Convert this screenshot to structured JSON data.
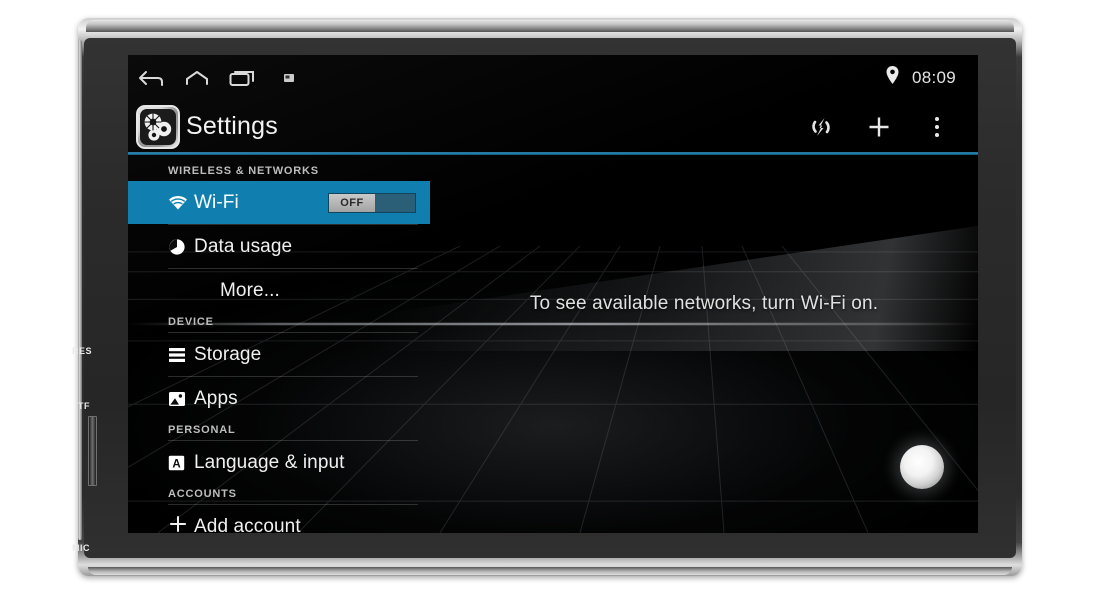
{
  "device": {
    "bezel_labels": [
      {
        "name": "reset",
        "text": "RES"
      },
      {
        "name": "tf-card-slot",
        "text": "TF"
      },
      {
        "name": "microphone",
        "text": "MIC"
      }
    ]
  },
  "statusbar": {
    "nav": [
      {
        "name": "back-icon",
        "label": "Back"
      },
      {
        "name": "home-icon",
        "label": "Home"
      },
      {
        "name": "recents-icon",
        "label": "Recent apps"
      },
      {
        "name": "screenshot-icon",
        "label": "Screenshot"
      }
    ],
    "location_icon": "location-pin-icon",
    "time": "08:09"
  },
  "actionbar": {
    "app_icon": "settings-gear-icon",
    "title": "Settings",
    "actions": [
      {
        "name": "sync-icon",
        "label": "Sync"
      },
      {
        "name": "add-icon",
        "label": "+"
      },
      {
        "name": "overflow-menu-icon",
        "label": "More options"
      }
    ],
    "divider_color": "#1f84b8"
  },
  "colors": {
    "accent_blue": "#107fb0",
    "screen_bg": "#000000",
    "text_primary": "#f0f0f0",
    "section_header": "#bdbdbd"
  },
  "settings_list": {
    "sections": [
      {
        "header": "WIRELESS & NETWORKS",
        "items": [
          {
            "label": "Wi-Fi",
            "icon": "wifi-icon",
            "selected": true,
            "toggle": {
              "state": "OFF",
              "checked": false
            }
          },
          {
            "label": "Data usage",
            "icon": "data-usage-icon",
            "selected": false
          },
          {
            "label": "More...",
            "icon": null,
            "selected": false
          }
        ]
      },
      {
        "header": "DEVICE",
        "items": [
          {
            "label": "Storage",
            "icon": "storage-icon",
            "selected": false
          },
          {
            "label": "Apps",
            "icon": "apps-icon",
            "selected": false
          }
        ]
      },
      {
        "header": "PERSONAL",
        "items": [
          {
            "label": "Language & input",
            "icon": "language-input-icon",
            "selected": false
          }
        ]
      },
      {
        "header": "ACCOUNTS",
        "items": [
          {
            "label": "Add account",
            "icon": "plus-icon",
            "selected": false
          }
        ]
      }
    ]
  },
  "content_pane": {
    "empty_message": "To see available networks, turn Wi-Fi on."
  }
}
